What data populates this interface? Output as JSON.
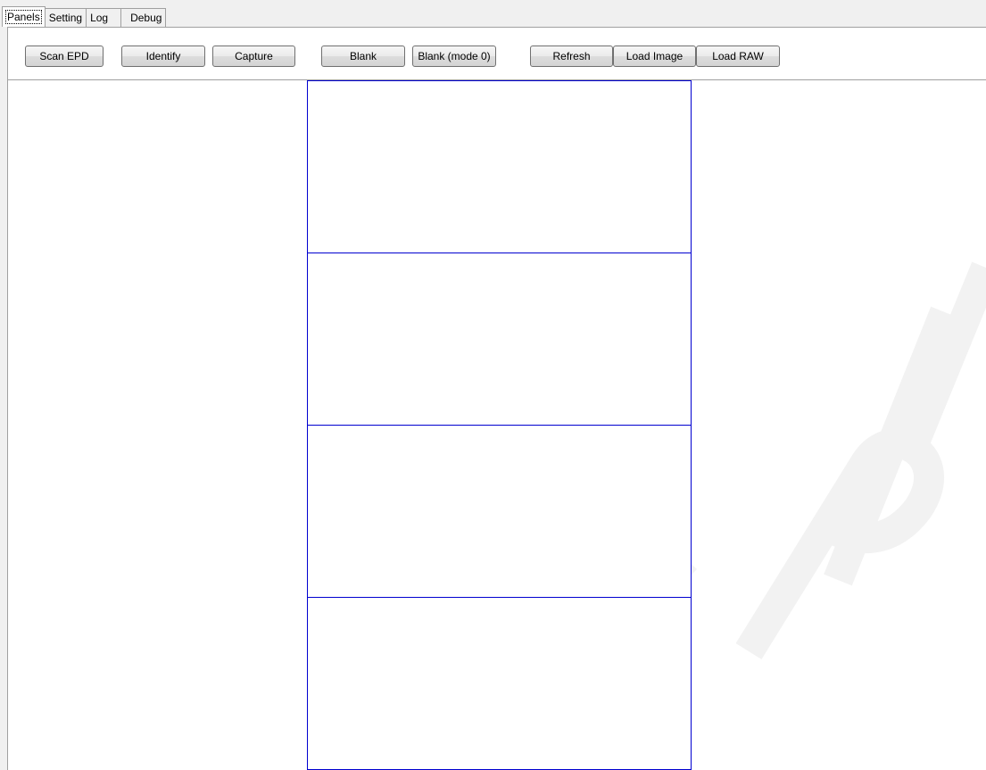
{
  "tabs": [
    {
      "label": "Panels",
      "active": true
    },
    {
      "label": "Setting",
      "active": false
    },
    {
      "label": "Log",
      "active": false
    },
    {
      "label": "Debug",
      "active": false
    }
  ],
  "toolbar": {
    "buttons": [
      {
        "label": "Scan EPD"
      },
      {
        "label": "Identify"
      },
      {
        "label": "Capture"
      },
      {
        "label": "Blank"
      },
      {
        "label": "Blank (mode 0)"
      },
      {
        "label": "Refresh"
      },
      {
        "label": "Load Image"
      },
      {
        "label": "Load RAW"
      }
    ]
  },
  "panels": {
    "count": 4,
    "border_color": "#0000d0"
  },
  "watermark": {
    "text": "ISPLAY",
    "color": "#f2f2f2"
  }
}
